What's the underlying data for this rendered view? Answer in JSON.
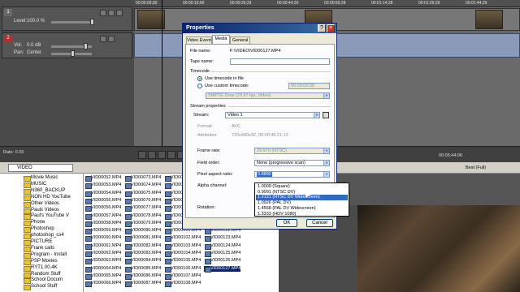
{
  "tracks": {
    "video_track": {
      "number": "1",
      "level_label": "Level:",
      "level_value": "100.0 %"
    },
    "audio_track": {
      "number": "2",
      "vol_label": "Vol:",
      "vol_value": "0.0 dB",
      "pan_label": "Pan:",
      "pan_value": "Center"
    }
  },
  "ruler": {
    "labels": [
      "00:00:00;00",
      "00:00:15;00",
      "00:00:29;29",
      "00:00:44;29",
      "00:00:59;28",
      "00:01:14;28",
      "00:01:29;29",
      "00:01:44;29"
    ]
  },
  "transport": {
    "rate_label": "Rate: 0.00",
    "timecode": "00:05:44:06",
    "quality_label": "Best (Full)"
  },
  "explorer": {
    "path": "VIDEO",
    "folders": [
      "Movie Music",
      "MUSIC",
      "N360_BACKUP",
      "NON HD YouTube",
      "Other Videos",
      "Pauls Videos",
      "Paul's YouTube V",
      "Phone",
      "Photoshop",
      "photoshop_cs4",
      "PICTURE",
      "Frank calls",
      "Program - Install",
      "PSP Movies",
      "RYT1.00.4K",
      "Random Stuff",
      "School Docum",
      "School Stuff"
    ],
    "file_columns": [
      [
        "VID00052.MP4",
        "VID00053.MP4",
        "VID00054.MP4",
        "VID00055.MP4",
        "VID00056.MP4",
        "VID00057.MP4",
        "VID00058.MP4",
        "VID00059.MP4",
        "VID00060.MP4",
        "VID00061.MP4",
        "VID00062.MP4",
        "VID00063.MP4",
        "VID00064.MP4",
        "VID00065.MP4",
        "VID00066.MP4"
      ],
      [
        "VID00073.MP4",
        "VID00074.MP4",
        "VID00075.MP4",
        "VID00076.MP4",
        "VID00077.MP4",
        "VID00078.MP4",
        "VID00079.MP4",
        "VID00080.MP4",
        "VID00081.MP4",
        "VID00082.MP4",
        "VID00083.MP4",
        "VID00084.MP4",
        "VID00085.MP4",
        "VID00086.MP4",
        "VID00087.MP4"
      ],
      [
        "VID00094.MP4",
        "VID00095.MP4",
        "VID00096.MP4",
        "VID00097.MP4",
        "VID00098.MP4",
        "VID00099.MP4",
        "VID00100.MP4",
        "VID00101.MP4",
        "VID00102.MP4",
        "VID00103.MP4",
        "VID00104.MP4",
        "VID00105.MP4",
        "VID00106.MP4",
        "VID00107.MP4",
        "VID00108.MP4"
      ],
      [
        "VID00115.MP4",
        "VID00116.MP4",
        "VID00117.MP4",
        "VID00118.MP4",
        "VID00119.MP4",
        "VID00120.MP4",
        "VID00121.MP4",
        "VID00122.MP4",
        "VID00123.MP4",
        "VID00124.MP4",
        "VID00125.MP4",
        "VID00126.MP4",
        "VID00127.MP4"
      ]
    ],
    "selected_file": "VID00127.MP4"
  },
  "dialog": {
    "title": "Properties",
    "tabs": [
      "Video Event",
      "Media",
      "General"
    ],
    "active_tab": "Media",
    "file_name_label": "File name:",
    "file_name_value": "F:\\VIDEO\\VID00127.MP4",
    "tape_name_label": "Tape name:",
    "timecode_group": "Timecode",
    "use_timecode_in_file": "Use timecode in file",
    "use_custom_timecode": "Use custom timecode:",
    "custom_timecode_value": "00:00:00:00",
    "timecode_format": "SMPTE Drop (29.97 fps, Video)",
    "stream_group": "Stream properties",
    "stream_label": "Stream:",
    "stream_value": "Video 1",
    "format_label": "Format:",
    "format_value": "AVC",
    "attributes_label": "Attributes:",
    "attributes_value": "720x480x32, 00:00:46:21:12",
    "frame_rate_label": "Frame rate:",
    "frame_rate_value": "29.970 (NTSC)",
    "field_order_label": "Field order:",
    "field_order_value": "None (progressive scan)",
    "par_label": "Pixel aspect ratio:",
    "par_value": "0.8889",
    "alpha_label": "Alpha channel:",
    "rotation_label": "Rotation:",
    "par_options": [
      "1.0000 (Square)",
      "0.9091 (NTSC DV)",
      "1.2121 (NTSC DV Widescreen)",
      "1.0926 (PAL DV)",
      "1.4568 (PAL DV Widescreen)",
      "1.3333 (HDV 1080)"
    ],
    "par_highlighted": "1.2121 (NTSC DV Widescreen)",
    "ok_label": "OK",
    "cancel_label": "Cancel",
    "help_glyph": "?",
    "close_glyph": "×"
  }
}
